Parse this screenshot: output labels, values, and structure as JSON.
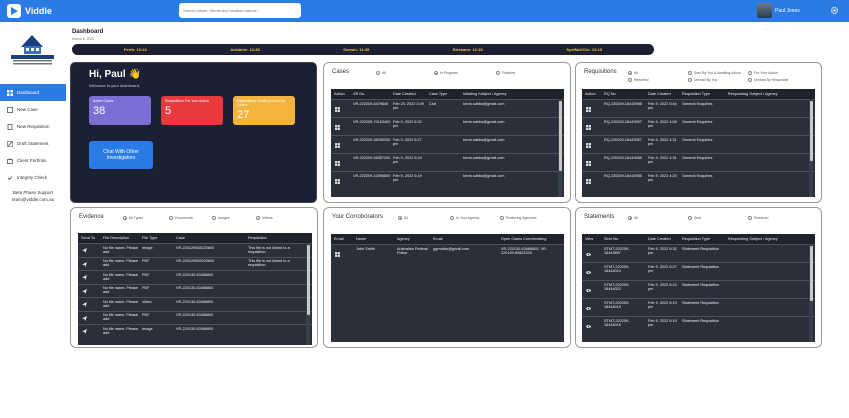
{
  "app": {
    "name": "Viddle"
  },
  "search": {
    "placeholder": "Search cases, clients and location names..."
  },
  "user": {
    "name": "Paul Jones"
  },
  "sidebar": {
    "items": [
      {
        "label": "Dashboard",
        "icon": "dashboard-icon"
      },
      {
        "label": "New Case",
        "icon": "new-case-icon"
      },
      {
        "label": "New Requisition",
        "icon": "requisition-icon"
      },
      {
        "label": "Draft Statement",
        "icon": "draft-icon"
      },
      {
        "label": "Client Portfolio",
        "icon": "portfolio-icon"
      },
      {
        "label": "Integrity Check",
        "icon": "integrity-icon"
      }
    ],
    "support_label": "Beta Phase Support",
    "support_email": "team@viddle.com.au"
  },
  "header": {
    "title": "Dashboard",
    "date": "March 8, 2022"
  },
  "clocks": [
    "Perth: 10:15",
    "Adelaide: 12:45",
    "Darwin: 11:45",
    "Brisbane: 12:15",
    "Syd/Mel/Cbr: 13:15"
  ],
  "hero": {
    "greeting": "Hi, Paul 👋",
    "welcome": "Welcome to your dashboard.",
    "stats": [
      {
        "label": "Active Cases",
        "value": "38",
        "color": "#7b6fd6"
      },
      {
        "label": "Requisitions For Your Action",
        "value": "5",
        "color": "#e8393f"
      },
      {
        "label": "Requisitions Awaiting Action by Others",
        "value": "27",
        "color": "#f4b43b"
      }
    ],
    "chat_label": "Chat With Other Investigators"
  },
  "cases": {
    "title": "Cases",
    "filters": [
      {
        "label": "All",
        "on": false
      },
      {
        "label": "In Progress",
        "on": true
      },
      {
        "label": "Finished",
        "on": false
      }
    ],
    "headers": [
      "Action",
      "VR No.",
      "Date Created",
      "Case Type",
      "Initiating Subject / Agency"
    ],
    "rows": [
      [
        "VR-220209-6479840",
        "Feb 25, 2022 3:09 pm",
        "Civil",
        "kevin.sahba@gmail.com"
      ],
      [
        "VR-220209-70163400",
        "Feb 9, 2022 6:32 pm",
        "",
        "kevin.sahba@gmail.com"
      ],
      [
        "VR-220209-36290000",
        "Feb 9, 2022 6:27 pm",
        "",
        "kevin.sahba@gmail.com"
      ],
      [
        "VR-220209-56357200",
        "Feb 9, 2022 6:24 pm",
        "",
        "kevin.sahba@gmail.com"
      ],
      [
        "VR-220209-10096500",
        "Feb 9, 2022 6:19 pm",
        "",
        "kevin.sahba@gmail.com"
      ]
    ]
  },
  "requisitions": {
    "title": "Requisitions",
    "filters": [
      {
        "label": "All",
        "on": true
      },
      {
        "label": "Sent By You & Awaiting Action",
        "on": false
      },
      {
        "label": "For Your Action",
        "on": false
      },
      {
        "label": "Returned",
        "on": false
      },
      {
        "label": "Unread By You",
        "on": false
      },
      {
        "label": "Unread By Responder",
        "on": false
      }
    ],
    "headers": [
      "Action",
      "RQ No.",
      "Date Created",
      "Requisition Type",
      "Responding Subject / Agency"
    ],
    "rows": [
      [
        "RQ-220209-16443998",
        "Feb 9, 2022 5:44 pm",
        "General Enquiries",
        ""
      ],
      [
        "RQ-220209-16443997",
        "Feb 9, 2022 4:58 pm",
        "General Enquiries",
        ""
      ],
      [
        "RQ-220209-16443957",
        "Feb 9, 2022 4:31 pm",
        "General Enquiries",
        ""
      ],
      [
        "RQ-220209-16443958",
        "Feb 9, 2022 4:31 pm",
        "General Enquiries",
        ""
      ],
      [
        "RQ-220209-16443955",
        "Feb 9, 2022 4:20 pm",
        "General Enquiries",
        ""
      ]
    ]
  },
  "evidence": {
    "title": "Evidence",
    "filters": [
      {
        "label": "All Types",
        "on": true
      },
      {
        "label": "Documents",
        "on": false
      },
      {
        "label": "Images",
        "on": false
      },
      {
        "label": "Videos",
        "on": false
      }
    ],
    "headers": [
      "Send To",
      "File Description",
      "File Type",
      "Case",
      "Requisition"
    ],
    "rows": [
      [
        "No file name. Please add",
        "Image",
        "VR-220129553220600",
        "This file is not linked to a requisition."
      ],
      [
        "No file name. Please add",
        "PDF",
        "VR-220129553220600",
        "This file is not linked to a requisition."
      ],
      [
        "No file name. Please add",
        "PDF",
        "VR-220130-63466800",
        ""
      ],
      [
        "No file name. Please add",
        "PDF",
        "VR-220130-63466800",
        ""
      ],
      [
        "No file name. Please add",
        "Video",
        "VR-220130-63466800",
        ""
      ],
      [
        "No file name. Please add",
        "PDF",
        "VR-220130-63466800",
        ""
      ],
      [
        "No file name. Please add",
        "Image",
        "VR-220130-63466800",
        ""
      ]
    ]
  },
  "corroborators": {
    "title": "Your Corroborators",
    "filters": [
      {
        "label": "All",
        "on": true
      },
      {
        "label": "In Your Agency",
        "on": false
      },
      {
        "label": "Preferring Agencies",
        "on": false
      }
    ],
    "headers": [
      "Email",
      "Name",
      "Agency",
      "Email",
      "Open Cases Corroborating"
    ],
    "rows": [
      [
        "John Smith",
        "Australian Federal Police",
        "ggmotiss@gmail.com",
        "VR-220130-63466800, VR-220129-69822200"
      ]
    ]
  },
  "statements": {
    "title": "Statements",
    "filters": [
      {
        "label": "All",
        "on": true
      },
      {
        "label": "Sent",
        "on": false
      },
      {
        "label": "Returned",
        "on": false
      }
    ],
    "headers": [
      "View",
      "Stmt No.",
      "Date Created",
      "Requisition Type",
      "Responding Subject / Agency"
    ],
    "rows": [
      [
        "STMT-220209-16443897",
        "Feb 9, 2022 6:32 pm",
        "Statement Requisition",
        ""
      ],
      [
        "STMT-220209-16444024",
        "Feb 9, 2022 6:27 pm",
        "Statement Requisition",
        ""
      ],
      [
        "STMT-220209-16444022",
        "Feb 9, 2022 6:24 pm",
        "Statement Requisition",
        ""
      ],
      [
        "STMT-220209-16444019",
        "Feb 9, 2022 6:19 pm",
        "Statement Requisition",
        ""
      ],
      [
        "STMT-220209-16444016",
        "Feb 9, 2022 6:19 pm",
        "Statement Requisition",
        ""
      ]
    ]
  }
}
